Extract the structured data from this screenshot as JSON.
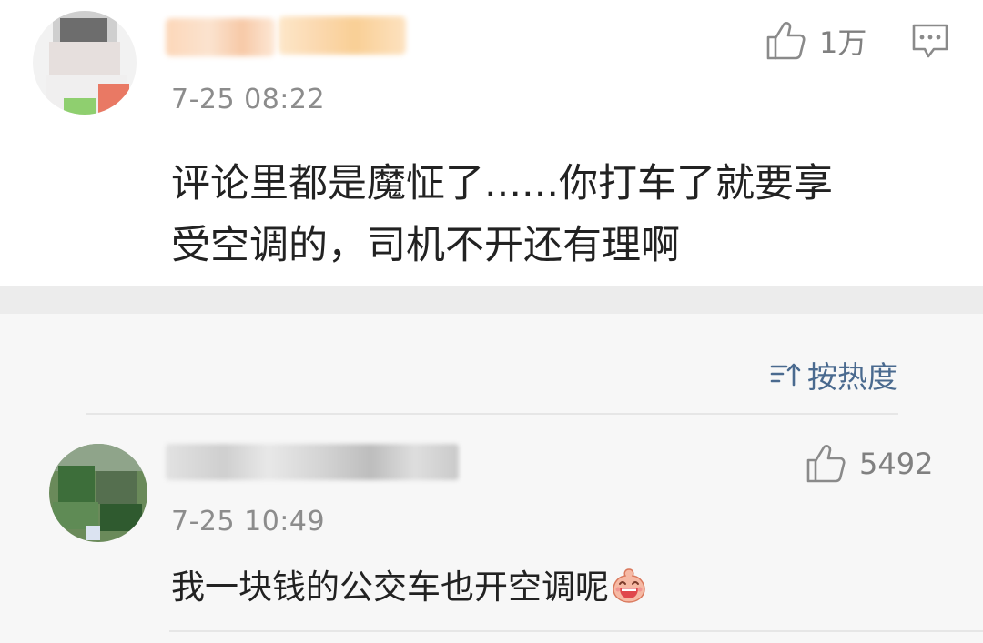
{
  "main_comment": {
    "timestamp": "7-25 08:22",
    "like_count": "1万",
    "content_line1": "评论里都是魔怔了......你打车了就要享",
    "content_line2": "受空调的，司机不开还有理啊"
  },
  "sort": {
    "label": "按热度"
  },
  "reply": {
    "timestamp": "7-25 10:49",
    "like_count": "5492",
    "content": "我一块钱的公交车也开空调呢"
  },
  "icons": {
    "like": "thumbs-up-icon",
    "reply": "comment-icon",
    "sort": "sort-icon",
    "emoji": "laughing-emoji-icon"
  },
  "colors": {
    "accent_blue": "#4a6a8f",
    "meta_gray": "#8c8c8c",
    "band_gray": "#ececec"
  }
}
